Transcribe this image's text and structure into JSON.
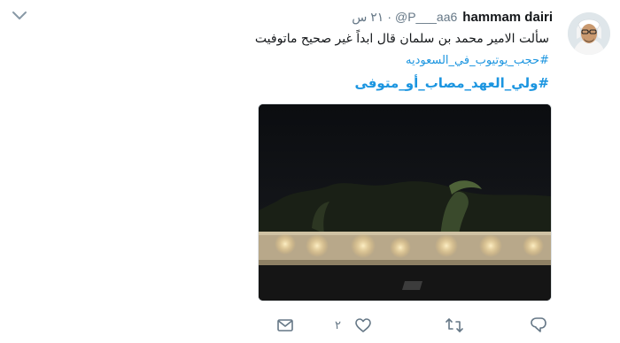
{
  "tweet": {
    "display_name": "hammam dairi",
    "handle": "@P___aa6",
    "separator": "·",
    "time": "٢١ س",
    "text": "سألت الامير محمد بن سلمان قال ابداً غير صحيح ماتوفيت",
    "hashtags": [
      "#حجب_يوتيوب_في_السعوديه",
      "#ولي_العهد_مصاب_أو_متوفى"
    ]
  },
  "actions": {
    "like_count": "٢"
  },
  "icons": {
    "menu": "chevron-down-icon",
    "dm": "envelope-icon",
    "like": "heart-icon",
    "retweet": "retweet-icon",
    "reply": "reply-icon"
  },
  "colors": {
    "link": "#1b95e0",
    "secondary": "#657786",
    "text": "#14171a"
  }
}
